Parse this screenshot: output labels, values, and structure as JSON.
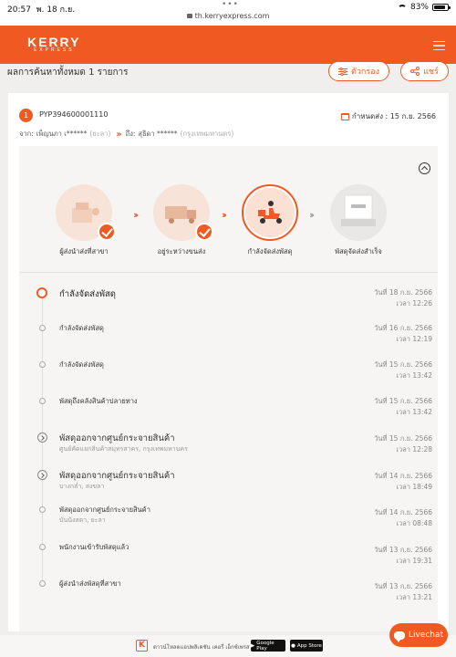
{
  "status_bar": {
    "time": "20:57",
    "date": "พ. 18 ก.ย.",
    "dots": "•••",
    "url": "th.kerryexpress.com",
    "battery": "83%",
    "battery_level": 0.83
  },
  "header": {
    "logo_main": "KERRY",
    "logo_sub": "EXPRESS"
  },
  "results": {
    "title": "ผลการค้นหาทั้งหมด 1 รายการ",
    "filter_label": "ตัวกรอง",
    "share_label": "แชร์"
  },
  "parcel": {
    "index": "1",
    "tracking_no": "PYP394600001110",
    "due_label": "กำหนดส่ง : 15 ก.ย. 2566",
    "from_label": "จาก:",
    "from_name": "เพ็ญนภา เ******",
    "from_area": "(ยะลา)",
    "to_label": "ถึง:",
    "to_name": "สุธิดา ******",
    "to_area": "(กรุงเทพมหานคร)"
  },
  "steps": [
    {
      "label": "ผู้ส่งนำส่งที่สาขา",
      "done": true
    },
    {
      "label": "อยู่ระหว่างขนส่ง",
      "done": true
    },
    {
      "label": "กำลังจัดส่งพัสดุ",
      "current": true
    },
    {
      "label": "พัสดุจัดส่งสำเร็จ",
      "done": false
    }
  ],
  "timeline": [
    {
      "title": "กำลังจัดส่งพัสดุ",
      "sub": "",
      "date": "วันที่ 18 ก.ย. 2566",
      "time": "เวลา 12:26"
    },
    {
      "title": "กำลังจัดส่งพัสดุ",
      "sub": "",
      "date": "วันที่ 16 ก.ย. 2566",
      "time": "เวลา 12:19"
    },
    {
      "title": "กำลังจัดส่งพัสดุ",
      "sub": "",
      "date": "วันที่ 15 ก.ย. 2566",
      "time": "เวลา 13:42"
    },
    {
      "title": "พัสดุถึงคลังสินค้าปลายทาง",
      "sub": "",
      "date": "วันที่ 15 ก.ย. 2566",
      "time": "เวลา 13:42"
    },
    {
      "title": "พัสดุออกจากศูนย์กระจายสินค้า",
      "sub": "ศูนย์คัดแยกสินค้าสมุทรสาคร, กรุงเทพมหานคร",
      "date": "วันที่ 15 ก.ย. 2566",
      "time": "เวลา 12:28"
    },
    {
      "title": "พัสดุออกจากศูนย์กระจายสินค้า",
      "sub": "บางกล่ำ, สงขลา",
      "date": "วันที่ 14 ก.ย. 2566",
      "time": "เวลา 18:49"
    },
    {
      "title": "พัสดุออกจากศูนย์กระจายสินค้า",
      "sub": "บันนังสตา, ยะลา",
      "date": "วันที่ 14 ก.ย. 2566",
      "time": "เวลา 08:48"
    },
    {
      "title": "พนักงานเข้ารับพัสดุแล้ว",
      "sub": "",
      "date": "วันที่ 13 ก.ย. 2566",
      "time": "เวลา 19:31"
    },
    {
      "title": "ผู้ส่งนำส่งพัสดุที่สาขา",
      "sub": "",
      "date": "วันที่ 13 ก.ย. 2566",
      "time": "เวลา 13:21"
    }
  ],
  "promo": {
    "k": "K",
    "text": "ดาวน์โหลดแอปพลิเคชัน เคอรี่ เอ็กซ์เพรส",
    "google_play": "Google Play",
    "app_store": "App Store"
  },
  "livechat": {
    "label": "Livechat"
  },
  "colors": {
    "brand": "#f05a22"
  }
}
